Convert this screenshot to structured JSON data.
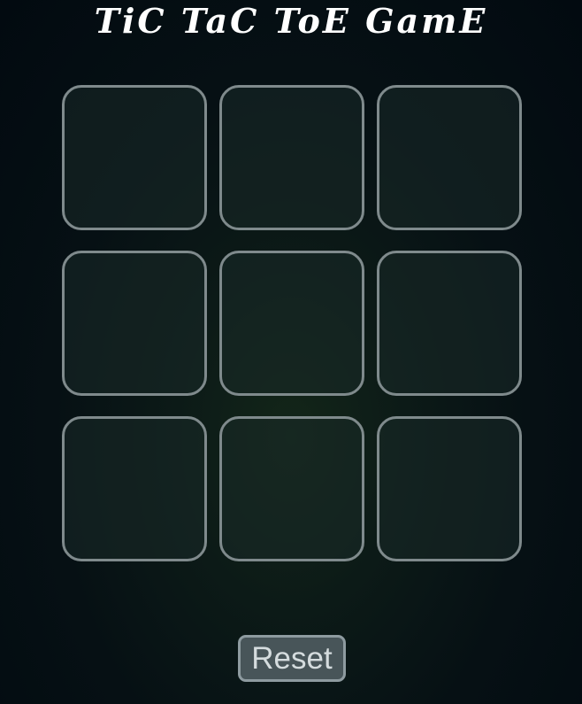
{
  "header": {
    "title": "TiC TaC ToE GamE"
  },
  "board": {
    "cells": [
      "",
      "",
      "",
      "",
      "",
      "",
      "",
      "",
      ""
    ]
  },
  "controls": {
    "reset_label": "Reset"
  },
  "colors": {
    "background": "#061014",
    "cell_border": "#7f8a8c",
    "button_background": "#485559",
    "title_text": "#ffffff"
  }
}
